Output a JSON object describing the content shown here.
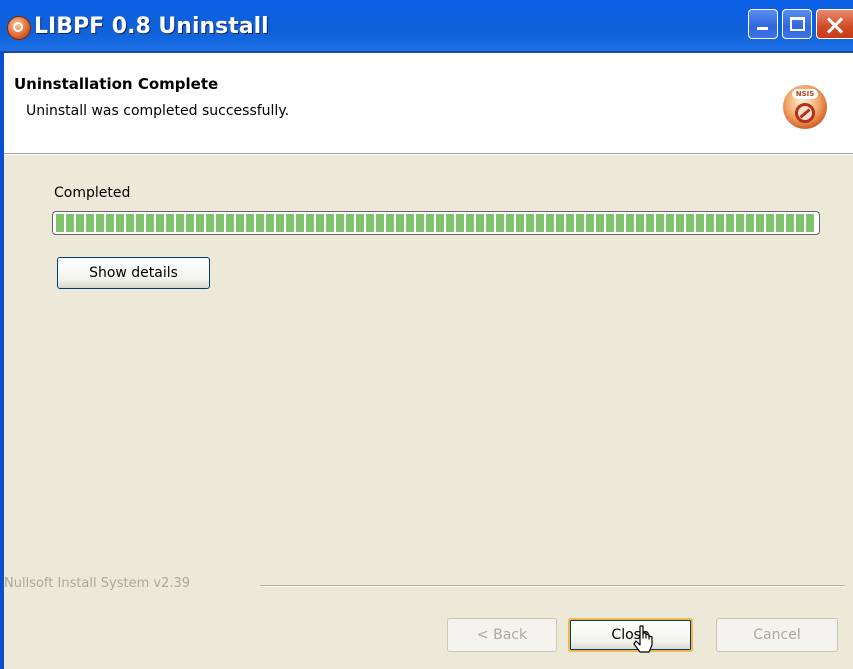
{
  "window": {
    "title": "LIBPF 0.8 Uninstall"
  },
  "header": {
    "title": "Uninstallation Complete",
    "subtitle": "Uninstall was completed successfully.",
    "icon_badge": "NSIS"
  },
  "body": {
    "status": "Completed",
    "progress_percent": 100,
    "show_details_label": "Show details"
  },
  "footer": {
    "branding": "Nullsoft Install System v2.39",
    "back_label": "< Back",
    "close_label": "Close",
    "cancel_label": "Cancel"
  },
  "colors": {
    "titlebar": "#0a5fe6",
    "progress": "#7fc36d",
    "dialog_bg": "#ece9d8"
  }
}
